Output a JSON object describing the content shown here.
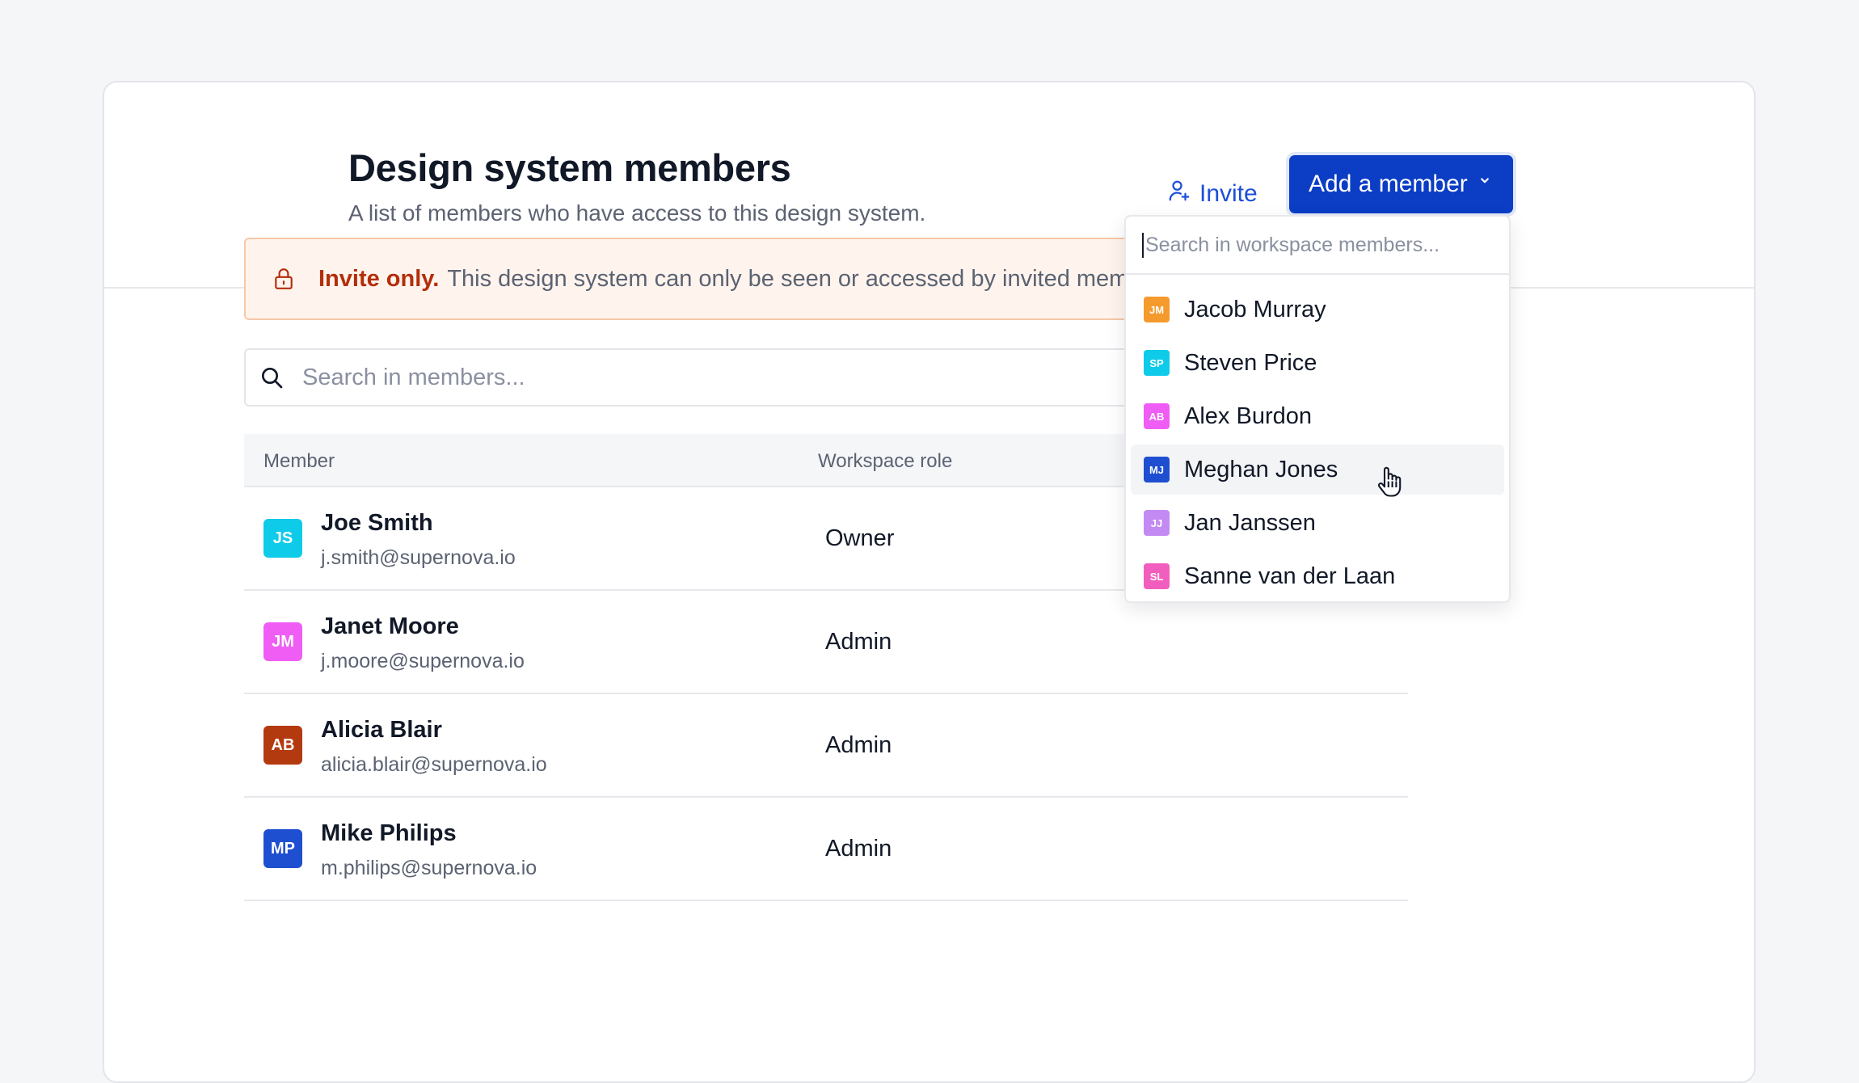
{
  "header": {
    "title": "Design system members",
    "subtitle": "A list of members who have access to this design system.",
    "invite_label": "Invite",
    "add_label": "Add a member"
  },
  "banner": {
    "strong": "Invite only.",
    "text": "This design system can only be seen or accessed by invited members."
  },
  "search": {
    "placeholder": "Search in members..."
  },
  "table": {
    "columns": [
      "Member",
      "Workspace role"
    ],
    "rows": [
      {
        "initials": "JS",
        "name": "Joe Smith",
        "email": "j.smith@supernova.io",
        "role": "Owner",
        "color": "#0ecbe9"
      },
      {
        "initials": "JM",
        "name": "Janet Moore",
        "email": "j.moore@supernova.io",
        "role": "Admin",
        "color": "#f05df5"
      },
      {
        "initials": "AB",
        "name": "Alicia Blair",
        "email": "alicia.blair@supernova.io",
        "role": "Admin",
        "color": "#b33a0e"
      },
      {
        "initials": "MP",
        "name": "Mike Philips",
        "email": "m.philips@supernova.io",
        "role": "Admin",
        "color": "#1f4fd1"
      }
    ]
  },
  "dropdown": {
    "placeholder": "Search in workspace members...",
    "items": [
      {
        "initials": "JM",
        "name": "Jacob Murray",
        "color": "#f59a2c"
      },
      {
        "initials": "SP",
        "name": "Steven Price",
        "color": "#0ecbe9"
      },
      {
        "initials": "AB",
        "name": "Alex Burdon",
        "color": "#f05df5"
      },
      {
        "initials": "MJ",
        "name": "Meghan Jones",
        "color": "#1f4fd1"
      },
      {
        "initials": "JJ",
        "name": "Jan Janssen",
        "color": "#c28af2"
      },
      {
        "initials": "SL",
        "name": "Sanne van der Laan",
        "color": "#f25ebd"
      }
    ],
    "hovered": "Meghan Jones"
  },
  "colors": {
    "primary": "#0b3dc5",
    "link": "#1d4ed8",
    "warning_text": "#b42e0a",
    "warning_bg": "#fff4ed"
  }
}
